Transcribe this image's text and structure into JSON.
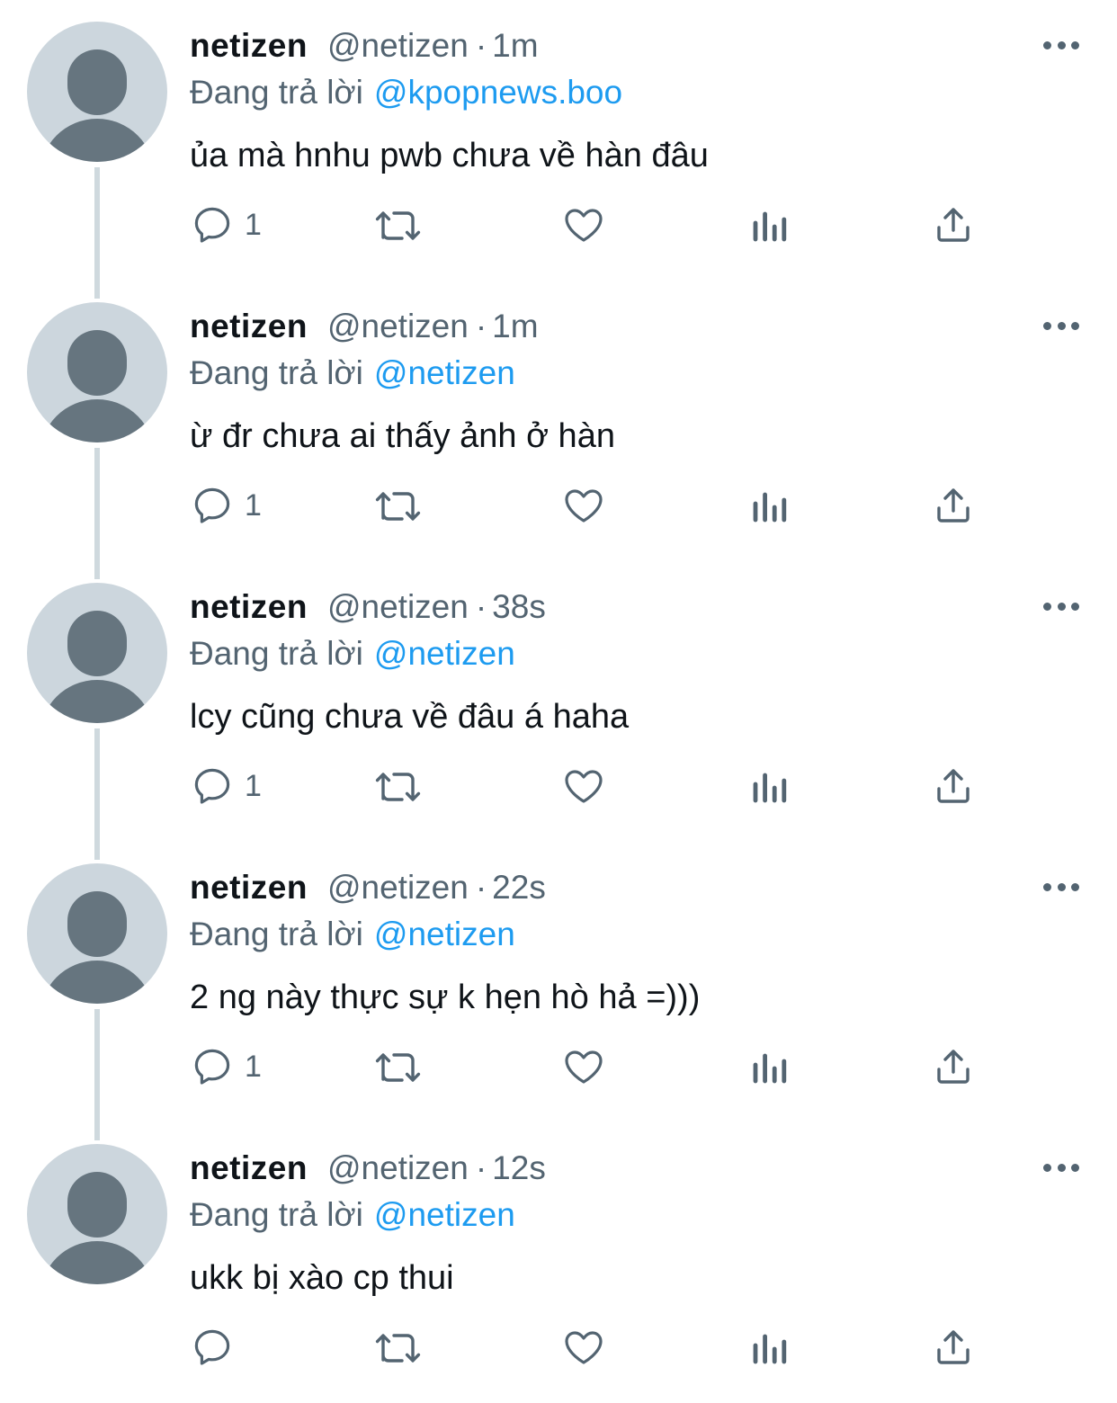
{
  "reply_prefix": "Đang trả lời",
  "more_icon": "more-horizontal-icon",
  "action_icons": [
    "reply-icon",
    "retweet-icon",
    "like-icon",
    "views-icon",
    "share-icon"
  ],
  "colors": {
    "text": "#0f1419",
    "secondary": "#536471",
    "link": "#1d9bf0",
    "avatar_bg": "#ccd6dd",
    "avatar_fg": "#66757f",
    "thread_line": "#cfd9de"
  },
  "tweets": [
    {
      "name": "netizen",
      "handle": "@netizen",
      "sep": "·",
      "time": "1m",
      "reply_to": "@kpopnews.boo",
      "text": "ủa mà hnhu pwb chưa về hàn đâu",
      "reply_count": "1"
    },
    {
      "name": "netizen",
      "handle": "@netizen",
      "sep": "·",
      "time": "1m",
      "reply_to": "@netizen",
      "text": "ừ đr chưa ai thấy ảnh ở hàn",
      "reply_count": "1"
    },
    {
      "name": "netizen",
      "handle": "@netizen",
      "sep": "·",
      "time": "38s",
      "reply_to": "@netizen",
      "text": "lcy cũng chưa về đâu á haha",
      "reply_count": "1"
    },
    {
      "name": "netizen",
      "handle": "@netizen",
      "sep": "·",
      "time": "22s",
      "reply_to": "@netizen",
      "text": "2 ng này thực sự k hẹn hò hả =)))",
      "reply_count": "1"
    },
    {
      "name": "netizen",
      "handle": "@netizen",
      "sep": "·",
      "time": "12s",
      "reply_to": "@netizen",
      "text": "ukk bị xào cp thui",
      "reply_count": ""
    }
  ]
}
